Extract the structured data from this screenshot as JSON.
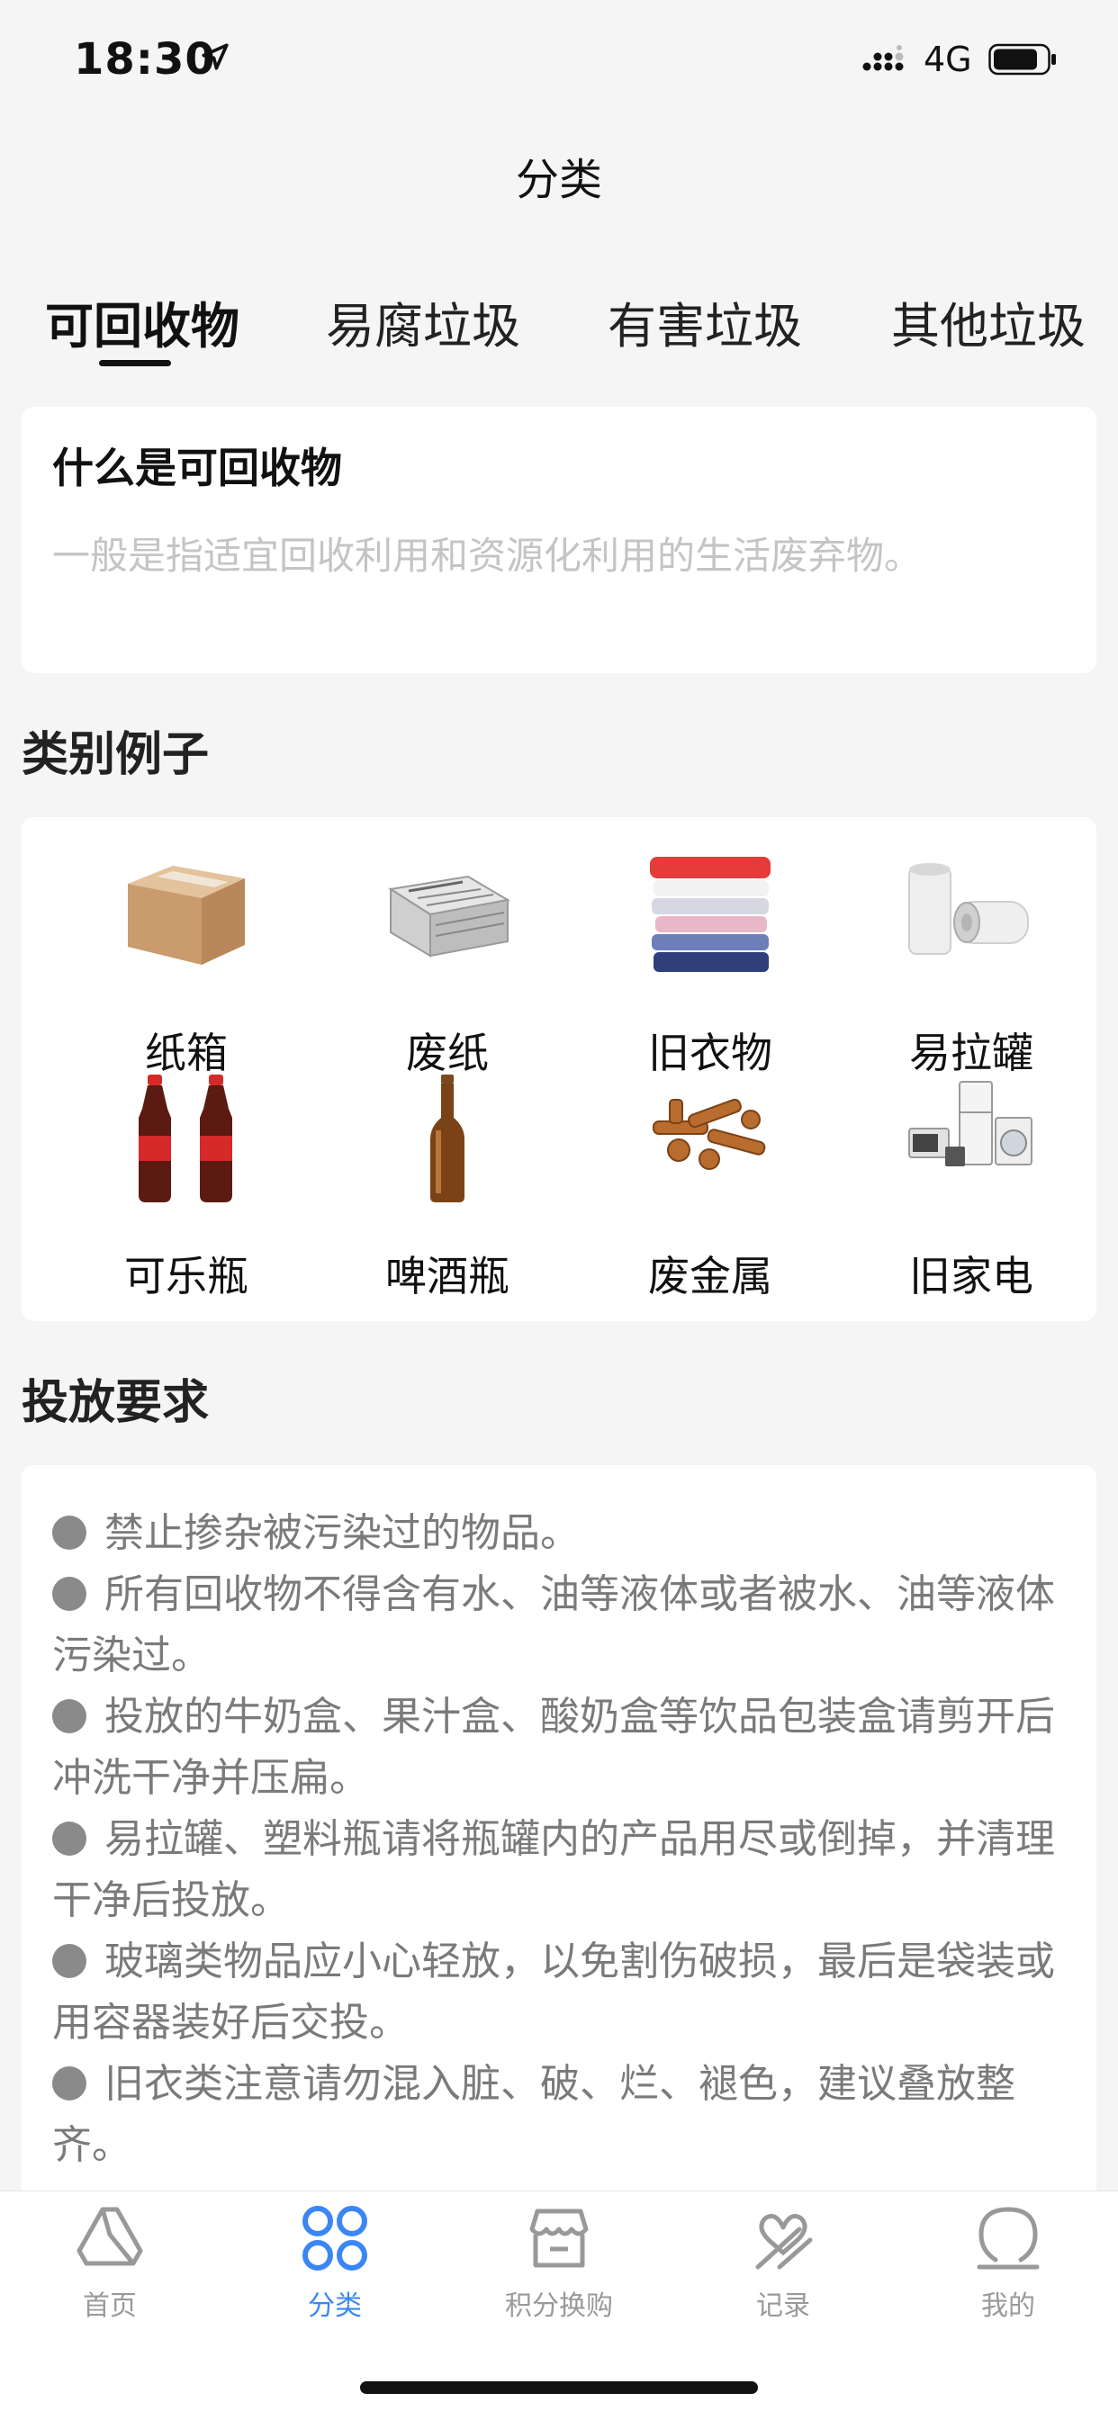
{
  "status_bar": {
    "time": "18:30",
    "network": "4G"
  },
  "nav": {
    "title": "分类"
  },
  "tabs": [
    {
      "label": "可回收物",
      "active": true
    },
    {
      "label": "易腐垃圾",
      "active": false
    },
    {
      "label": "有害垃圾",
      "active": false
    },
    {
      "label": "其他垃圾",
      "active": false
    }
  ],
  "intro": {
    "title": "什么是可回收物",
    "description": "一般是指适宜回收利用和资源化利用的生活废弃物。"
  },
  "examples": {
    "section_title": "类别例子",
    "items": [
      {
        "label": "纸箱",
        "icon": "cardboard-box-icon"
      },
      {
        "label": "废纸",
        "icon": "newspaper-icon"
      },
      {
        "label": "旧衣物",
        "icon": "folded-clothes-icon"
      },
      {
        "label": "易拉罐",
        "icon": "can-icon"
      },
      {
        "label": "可乐瓶",
        "icon": "cola-bottle-icon"
      },
      {
        "label": "啤酒瓶",
        "icon": "beer-bottle-icon"
      },
      {
        "label": "废金属",
        "icon": "metal-scrap-icon"
      },
      {
        "label": "旧家电",
        "icon": "appliance-icon"
      }
    ]
  },
  "rules": {
    "section_title": "投放要求",
    "items": [
      "禁止掺杂被污染过的物品。",
      "所有回收物不得含有水、油等液体或者被水、油等液体污染过。",
      "投放的牛奶盒、果汁盒、酸奶盒等饮品包装盒请剪开后冲洗干净并压扁。",
      "易拉罐、塑料瓶请将瓶罐内的产品用尽或倒掉，并清理干净后投放。",
      "玻璃类物品应小心轻放，以免割伤破损，最后是袋装或用容器装好后交投。",
      "旧衣类注意请勿混入脏、破、烂、褪色，建议叠放整齐。"
    ]
  },
  "tabbar": {
    "items": [
      {
        "label": "首页",
        "icon": "home-icon",
        "active": false
      },
      {
        "label": "分类",
        "icon": "category-icon",
        "active": true
      },
      {
        "label": "积分换购",
        "icon": "shop-icon",
        "active": false
      },
      {
        "label": "记录",
        "icon": "record-icon",
        "active": false
      },
      {
        "label": "我的",
        "icon": "profile-icon",
        "active": false
      }
    ]
  },
  "colors": {
    "accent": "#3b86f6",
    "inactive": "#999999",
    "background": "#f5f5f5"
  }
}
